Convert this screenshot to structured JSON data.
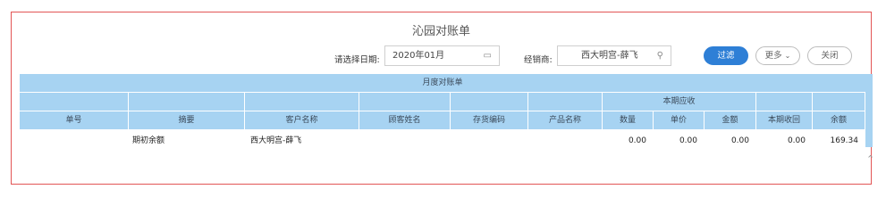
{
  "title": "沁园对账单",
  "filters": {
    "date_label": "请选择日期:",
    "date_value": "2020年01月",
    "dealer_label": "经销商:",
    "dealer_value": "西大明宫-薛飞"
  },
  "buttons": {
    "filter": "过滤",
    "more": "更多",
    "close": "关闭"
  },
  "table": {
    "group_title": "月度对账单",
    "period_group": "本期应收",
    "columns": [
      "单号",
      "摘要",
      "客户名称",
      "顾客姓名",
      "存货编码",
      "产品名称",
      "数量",
      "单价",
      "金额",
      "本期收回",
      "余额"
    ],
    "rows": [
      {
        "no": "",
        "summary": "期初余额",
        "customer": "西大明宫-薛飞",
        "guest": "",
        "stock_code": "",
        "product": "",
        "qty": "0.00",
        "price": "0.00",
        "amount": "0.00",
        "received": "0.00",
        "balance": "169.34"
      }
    ]
  },
  "colors": {
    "header_bg": "#a7d3f2",
    "accent": "#2e7fd6",
    "frame_border": "#e25555"
  }
}
